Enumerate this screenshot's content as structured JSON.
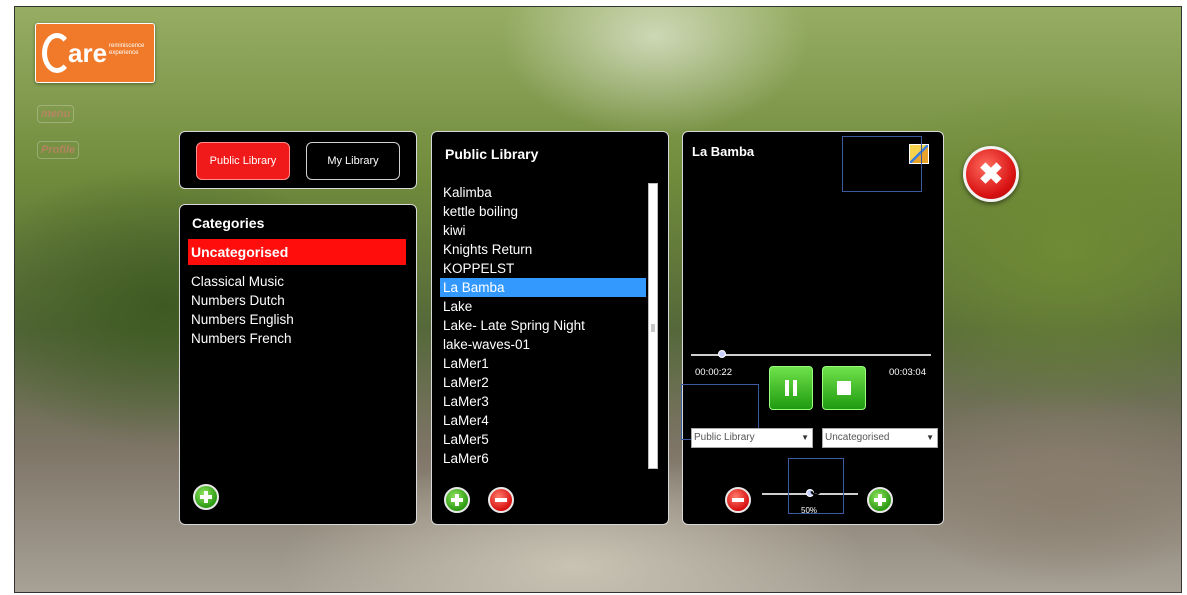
{
  "logo": {
    "word": "are",
    "sub_line1": "reminiscence",
    "sub_line2": "experience"
  },
  "side_menu": [
    "menu",
    "Profile"
  ],
  "tabs": {
    "public_label": "Public Library",
    "my_label": "My Library"
  },
  "categories": {
    "title": "Categories",
    "selected": "Uncategorised",
    "items": [
      "Classical Music",
      "Numbers Dutch",
      "Numbers English",
      "Numbers French"
    ]
  },
  "library": {
    "title": "Public Library",
    "items": [
      "Kalimba",
      "kettle boiling",
      "kiwi",
      "Knights Return",
      "KOPPELST",
      "La Bamba",
      "Lake",
      "Lake- Late Spring Night",
      "lake-waves-01",
      "LaMer1",
      "LaMer2",
      "LaMer3",
      "LaMer4",
      "LaMer5",
      "LaMer6"
    ],
    "selected": "La Bamba"
  },
  "player": {
    "title": "La Bamba",
    "elapsed": "00:00:22",
    "duration": "00:03:04",
    "progress_fraction": 0.13,
    "library_select": "Public Library",
    "category_select": "Uncategorised",
    "volume_label": "50%",
    "volume_fraction": 0.5
  },
  "annotations": [
    "11",
    "10",
    "9"
  ],
  "close_glyph": "✖"
}
